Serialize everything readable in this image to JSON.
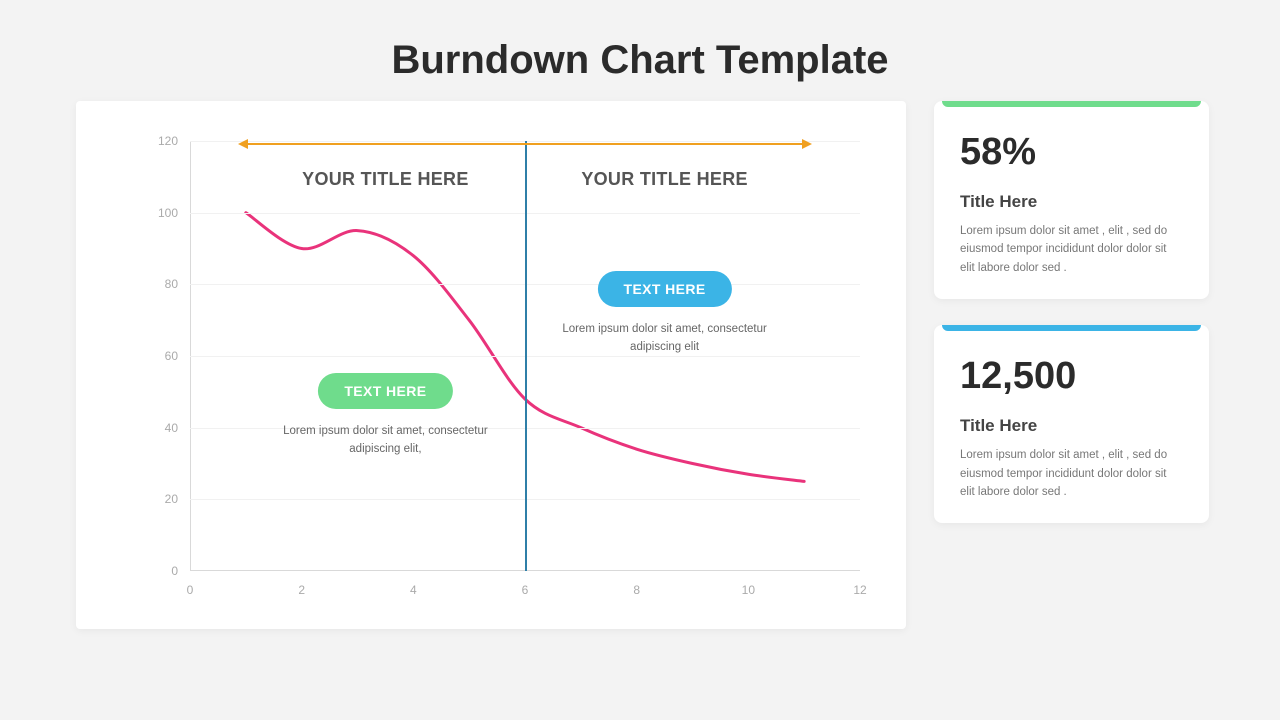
{
  "title": "Burndown Chart Template",
  "chart_data": {
    "type": "line",
    "x": [
      1,
      2,
      3,
      4,
      5,
      6,
      7,
      8,
      9,
      10,
      11
    ],
    "values": [
      100,
      90,
      95,
      88,
      70,
      48,
      40,
      34,
      30,
      27,
      25
    ],
    "xlabel": "",
    "ylabel": "",
    "xlim": [
      0,
      12
    ],
    "ylim": [
      0,
      120
    ],
    "x_ticks": [
      0,
      2,
      4,
      6,
      8,
      10,
      12
    ],
    "y_ticks": [
      0,
      20,
      40,
      60,
      80,
      100,
      120
    ],
    "divider_x": 6,
    "span": [
      1,
      11
    ],
    "series_color": "#e9337b",
    "sections": [
      {
        "title": "YOUR TITLE HERE",
        "pill": "TEXT HERE",
        "pill_color": "#6fdc8c",
        "caption": "Lorem ipsum dolor sit amet, consectetur adipiscing elit,"
      },
      {
        "title": "YOUR TITLE HERE",
        "pill": "TEXT HERE",
        "pill_color": "#3bb4e6",
        "caption": "Lorem ipsum dolor sit amet, consectetur adipiscing elit"
      }
    ]
  },
  "stats": [
    {
      "accent": "#6fdc8c",
      "value": "58%",
      "title": "Title Here",
      "body": "Lorem ipsum dolor sit amet , elit , sed do eiusmod tempor incididunt dolor dolor sit elit labore dolor sed ."
    },
    {
      "accent": "#3bb4e6",
      "value": "12,500",
      "title": "Title Here",
      "body": "Lorem ipsum dolor sit amet , elit , sed do eiusmod tempor incididunt dolor dolor sit elit labore dolor sed ."
    }
  ]
}
